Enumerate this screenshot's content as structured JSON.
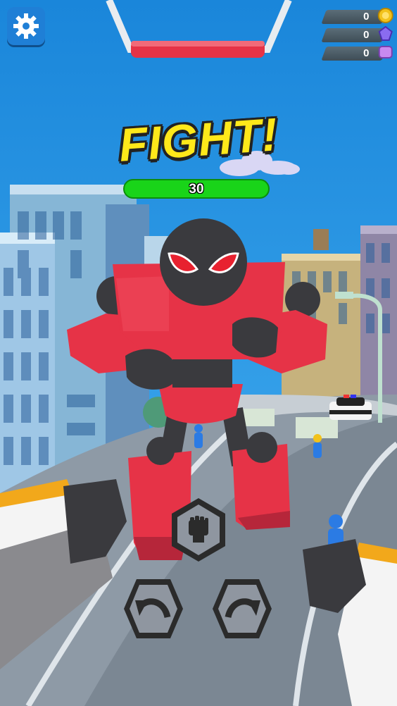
{
  "hud": {
    "title": "FIGHT!",
    "enemy_health": "30",
    "enemy_health_fraction": 1.0,
    "currencies": [
      {
        "name": "coin-icon",
        "value": "0",
        "color": "#f2c21b"
      },
      {
        "name": "gem-icon",
        "value": "0",
        "color": "#8a6cf0"
      },
      {
        "name": "ticket-icon",
        "value": "0",
        "color": "#c88af0"
      }
    ],
    "settings_icon": "gear-icon"
  },
  "controls": {
    "punch_icon": "fist-icon",
    "dodge_left_icon": "arrow-curve-left-icon",
    "dodge_right_icon": "arrow-curve-right-icon"
  },
  "colors": {
    "sky": "#1e8fe0",
    "robot_red": "#e63347",
    "robot_dark": "#3a3a3e",
    "health_green": "#19d419",
    "title_yellow": "#ffe81a"
  }
}
